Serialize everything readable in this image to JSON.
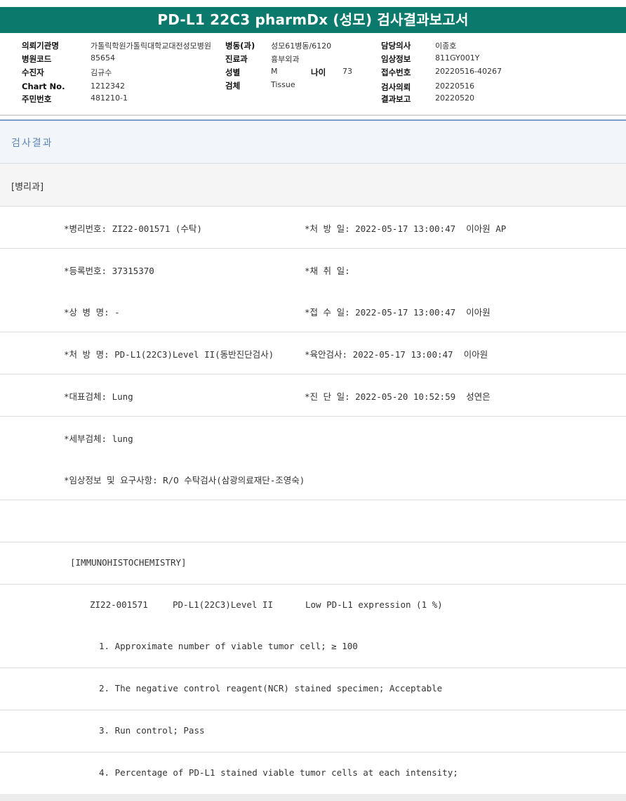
{
  "title": "PD-L1 22C3 pharmDx (성모) 검사결과보고서",
  "info": {
    "institution": {
      "label": "의뢰기관명",
      "value": "가톨릭학원가톨릭대학교대전성모병원"
    },
    "ward": {
      "label": "병동(과)",
      "value": "성모61병동/6120"
    },
    "doctor": {
      "label": "담당의사",
      "value": "이종호"
    },
    "hospital_code": {
      "label": "병원코드",
      "value": "85654"
    },
    "department": {
      "label": "진료과",
      "value": "흉부외과"
    },
    "clinical_info": {
      "label": "임상정보",
      "value": "811GY001Y"
    },
    "examinee": {
      "label": "수진자",
      "value": "김규수"
    },
    "sex": {
      "label": "성별",
      "value": "M"
    },
    "age": {
      "label": "나이",
      "value": "73"
    },
    "receipt_no": {
      "label": "접수번호",
      "value": "20220516-40267"
    },
    "chart_no": {
      "label": "Chart No.",
      "value": "1212342"
    },
    "specimen": {
      "label": "검체",
      "value": "Tissue"
    },
    "request_date": {
      "label": "검사의뢰",
      "value": "20220516"
    },
    "resident_no": {
      "label": "주민번호",
      "value": "481210-1"
    },
    "report_date": {
      "label": "결과보고",
      "value": "20220520"
    }
  },
  "section_title": "검사결과",
  "department_label": "[병리과]",
  "rows": [
    {
      "left": "*병리번호: ZI22-001571 (수탁)",
      "right": "*처 방 일: 2022-05-17 13:00:47  이아원 AP"
    },
    {
      "left": "*등록번호: 37315370",
      "right": "*채 취 일:"
    },
    {
      "left": "*상 병 명: -",
      "right": "*접 수 일: 2022-05-17 13:00:47  이아원"
    },
    {
      "left": "*처 방 명: PD-L1(22C3)Level II(동반진단검사)",
      "right": "*육안검사: 2022-05-17 13:00:47  이아원"
    },
    {
      "left": "*대표검체: Lung",
      "right": "*진 단 일: 2022-05-20 10:52:59  성연은"
    },
    {
      "left": "*세부검체: lung",
      "right": ""
    },
    {
      "left": "*임상정보 및 요구사항: R/O 수탁검사(삼광의료재단-조영숙)",
      "right": ""
    },
    {
      "left": "",
      "right": ""
    }
  ],
  "ihc": {
    "header": "[IMMUNOHISTOCHEMISTRY]",
    "result_id": "ZI22-001571",
    "result_test": "PD-L1(22C3)Level II",
    "result_value": "Low PD-L1 expression (1 %)",
    "items": [
      "1. Approximate number of viable tumor cell; ≥ 100",
      "2. The negative control reagent(NCR) stained specimen; Acceptable",
      "3. Run control; Pass",
      "4. Percentage of PD-L1 stained viable tumor cells at each intensity;"
    ]
  },
  "colors": {
    "title_bar": "#0b7a6c",
    "section_title": "#5d86b6",
    "divider": "#7a9cc6"
  }
}
